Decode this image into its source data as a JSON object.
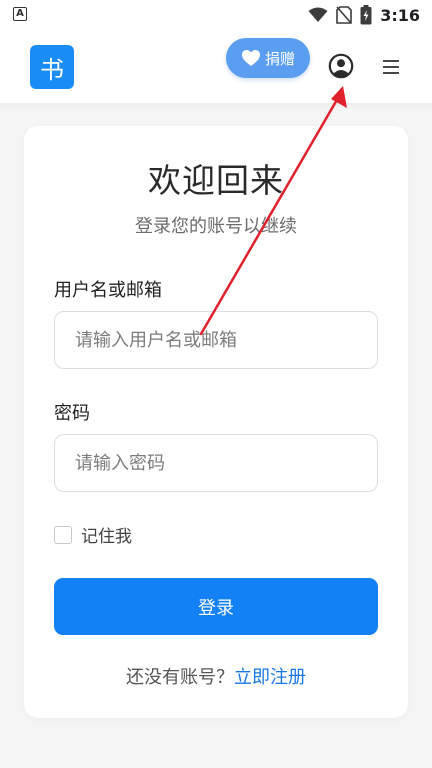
{
  "status_bar": {
    "left_icon_letter": "A",
    "time": "3:16",
    "icons": [
      "app-notification-icon",
      "wifi-icon",
      "no-sim-icon",
      "battery-charging-icon"
    ]
  },
  "header": {
    "logo_text": "书",
    "donate_label": "捐赠",
    "icons": [
      "heart-icon",
      "user-circle-icon",
      "menu-icon"
    ]
  },
  "login_card": {
    "title": "欢迎回来",
    "subtitle": "登录您的账号以继续",
    "username_label": "用户名或邮箱",
    "username_placeholder": "请输入用户名或邮箱",
    "password_label": "密码",
    "password_placeholder": "请输入密码",
    "remember_label": "记住我",
    "remember_checked": false,
    "login_button": "登录",
    "register_prompt": "还没有账号？",
    "register_link": "立即注册"
  },
  "colors": {
    "primary": "#1480f5",
    "logo": "#1a8cf5",
    "donate": "#5b9ef0",
    "annotation_arrow": "#e0202a"
  }
}
